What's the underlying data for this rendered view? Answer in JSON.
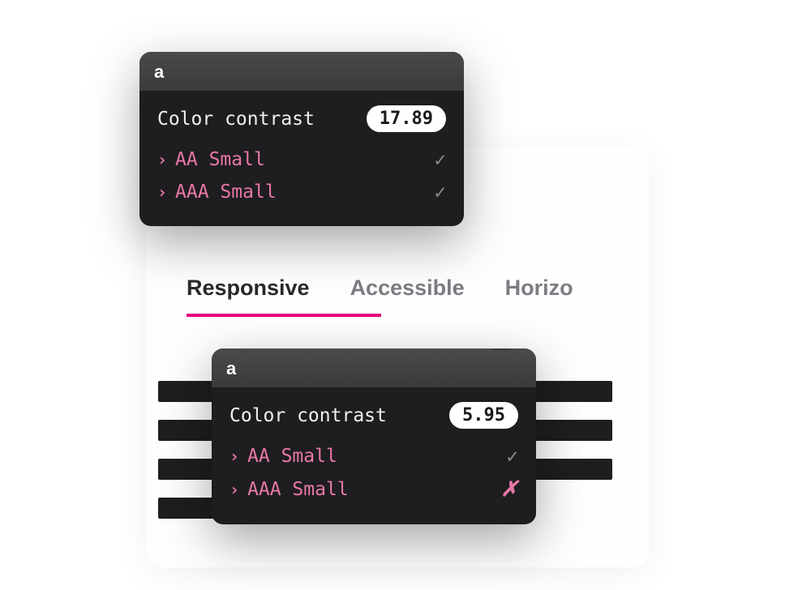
{
  "tabs": {
    "items": [
      {
        "label": "Responsive",
        "active": true
      },
      {
        "label": "Accessible",
        "active": false
      },
      {
        "label": "Horizo",
        "active": false
      }
    ]
  },
  "tooltip1": {
    "header_letter": "a",
    "contrast_label": "Color contrast",
    "contrast_value": "17.89",
    "checks": [
      {
        "label": "AA Small",
        "pass": true
      },
      {
        "label": "AAA Small",
        "pass": true
      }
    ]
  },
  "tooltip2": {
    "header_letter": "a",
    "contrast_label": "Color contrast",
    "contrast_value": "5.95",
    "checks": [
      {
        "label": "AA Small",
        "pass": true
      },
      {
        "label": "AAA Small",
        "pass": false
      }
    ]
  },
  "icons": {
    "caret": "›",
    "check": "✓",
    "fail": "✗"
  }
}
